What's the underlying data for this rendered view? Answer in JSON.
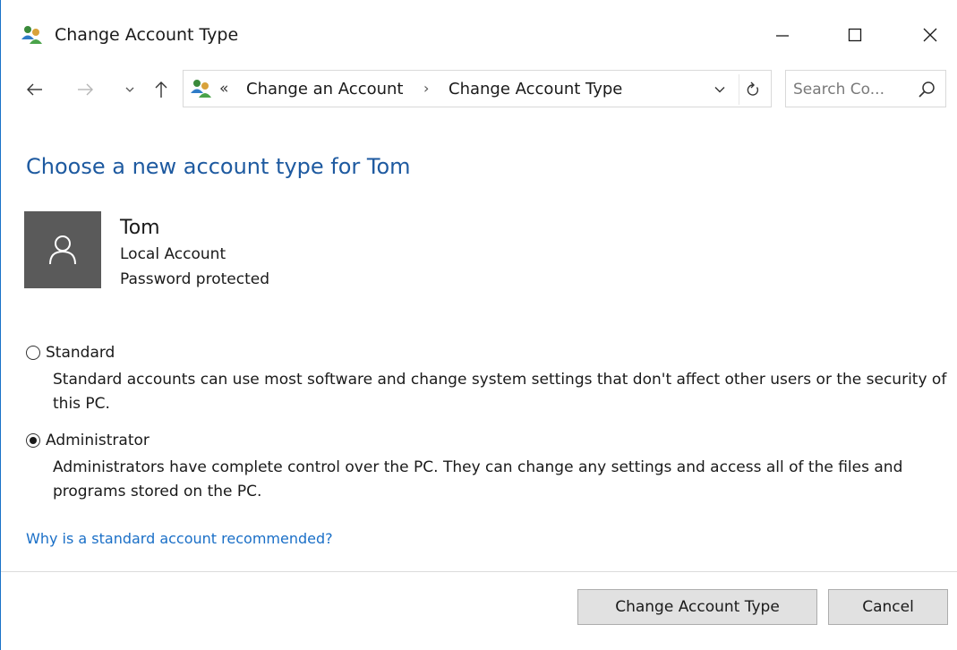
{
  "window": {
    "title": "Change Account Type"
  },
  "nav": {
    "breadcrumb_prefix": "«",
    "crumbs": [
      "Change an Account",
      "Change Account Type"
    ],
    "separator": "›",
    "search_placeholder": "Search Co..."
  },
  "main": {
    "heading": "Choose a new account type for Tom",
    "user": {
      "name": "Tom",
      "type": "Local Account",
      "status": "Password protected"
    },
    "options": [
      {
        "label": "Standard",
        "description": "Standard accounts can use most software and change system settings that don't affect other users or the security of this PC.",
        "selected": false
      },
      {
        "label": "Administrator",
        "description": "Administrators have complete control over the PC. They can change any settings and access all of the files and programs stored on the PC.",
        "selected": true
      }
    ],
    "help_link": "Why is a standard account recommended?"
  },
  "footer": {
    "primary_label": "Change Account Type",
    "cancel_label": "Cancel"
  },
  "colors": {
    "heading": "#1e5aa0",
    "link": "#1a6fc7",
    "avatar_bg": "#5a5a5a"
  },
  "icons": {
    "app": "users-icon",
    "back": "arrow-left-icon",
    "forward": "arrow-right-icon",
    "recent": "chevron-down-icon",
    "up": "arrow-up-icon",
    "refresh": "refresh-icon",
    "search": "search-icon",
    "avatar": "user-icon"
  }
}
